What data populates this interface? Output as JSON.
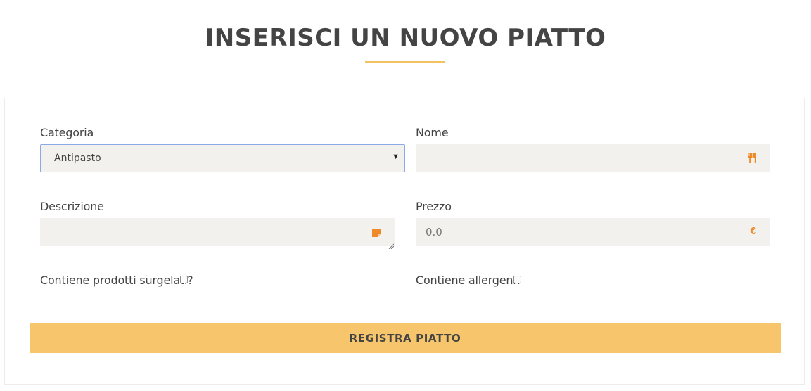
{
  "page": {
    "title": "INSERISCI UN NUOVO PIATTO"
  },
  "form": {
    "categoria": {
      "label": "Categoria",
      "selected": "Antipasto"
    },
    "nome": {
      "label": "Nome",
      "value": "",
      "icon": "cutlery-icon"
    },
    "descrizione": {
      "label": "Descrizione",
      "value": "",
      "icon": "note-icon"
    },
    "prezzo": {
      "label": "Prezzo",
      "value": "0.0",
      "icon": "euro-icon",
      "icon_glyph": "€"
    },
    "surgelati": {
      "label": "Contiene prodotti surgelati?",
      "checked": false
    },
    "allergeni": {
      "label": "Contiene allergeni?",
      "checked": false
    },
    "submit_label": "REGISTRA PIATTO"
  },
  "colors": {
    "accent": "#f7c66c",
    "underline": "#f3c262",
    "icon": "#ee8a2a",
    "field_bg": "#f2f1ed",
    "focus_border": "#8aa9e6",
    "text": "#444444"
  }
}
